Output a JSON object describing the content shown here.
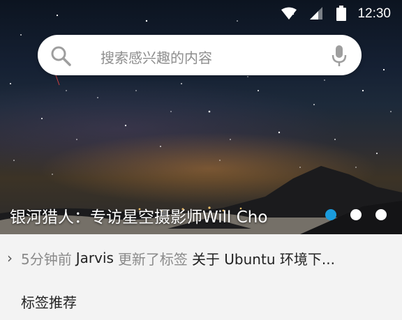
{
  "status_bar": {
    "time": "12:30",
    "icons": [
      "wifi-icon",
      "signal-icon",
      "battery-icon"
    ]
  },
  "search": {
    "placeholder": "搜索感兴趣的内容",
    "icons": [
      "search-icon",
      "mic-icon"
    ]
  },
  "banner": {
    "caption": "银河猎人：专访星空摄影师Will Cho",
    "dots_total": 3,
    "active_dot": 1,
    "colors": {
      "active_dot": "#1a9bdc",
      "inactive_dot": "#ffffff"
    }
  },
  "update": {
    "time": "5分钟前",
    "user": "Jarvis",
    "action": "更新了标签",
    "title": "关于 Ubuntu 环境下..."
  },
  "section": {
    "title": "标签推荐"
  }
}
